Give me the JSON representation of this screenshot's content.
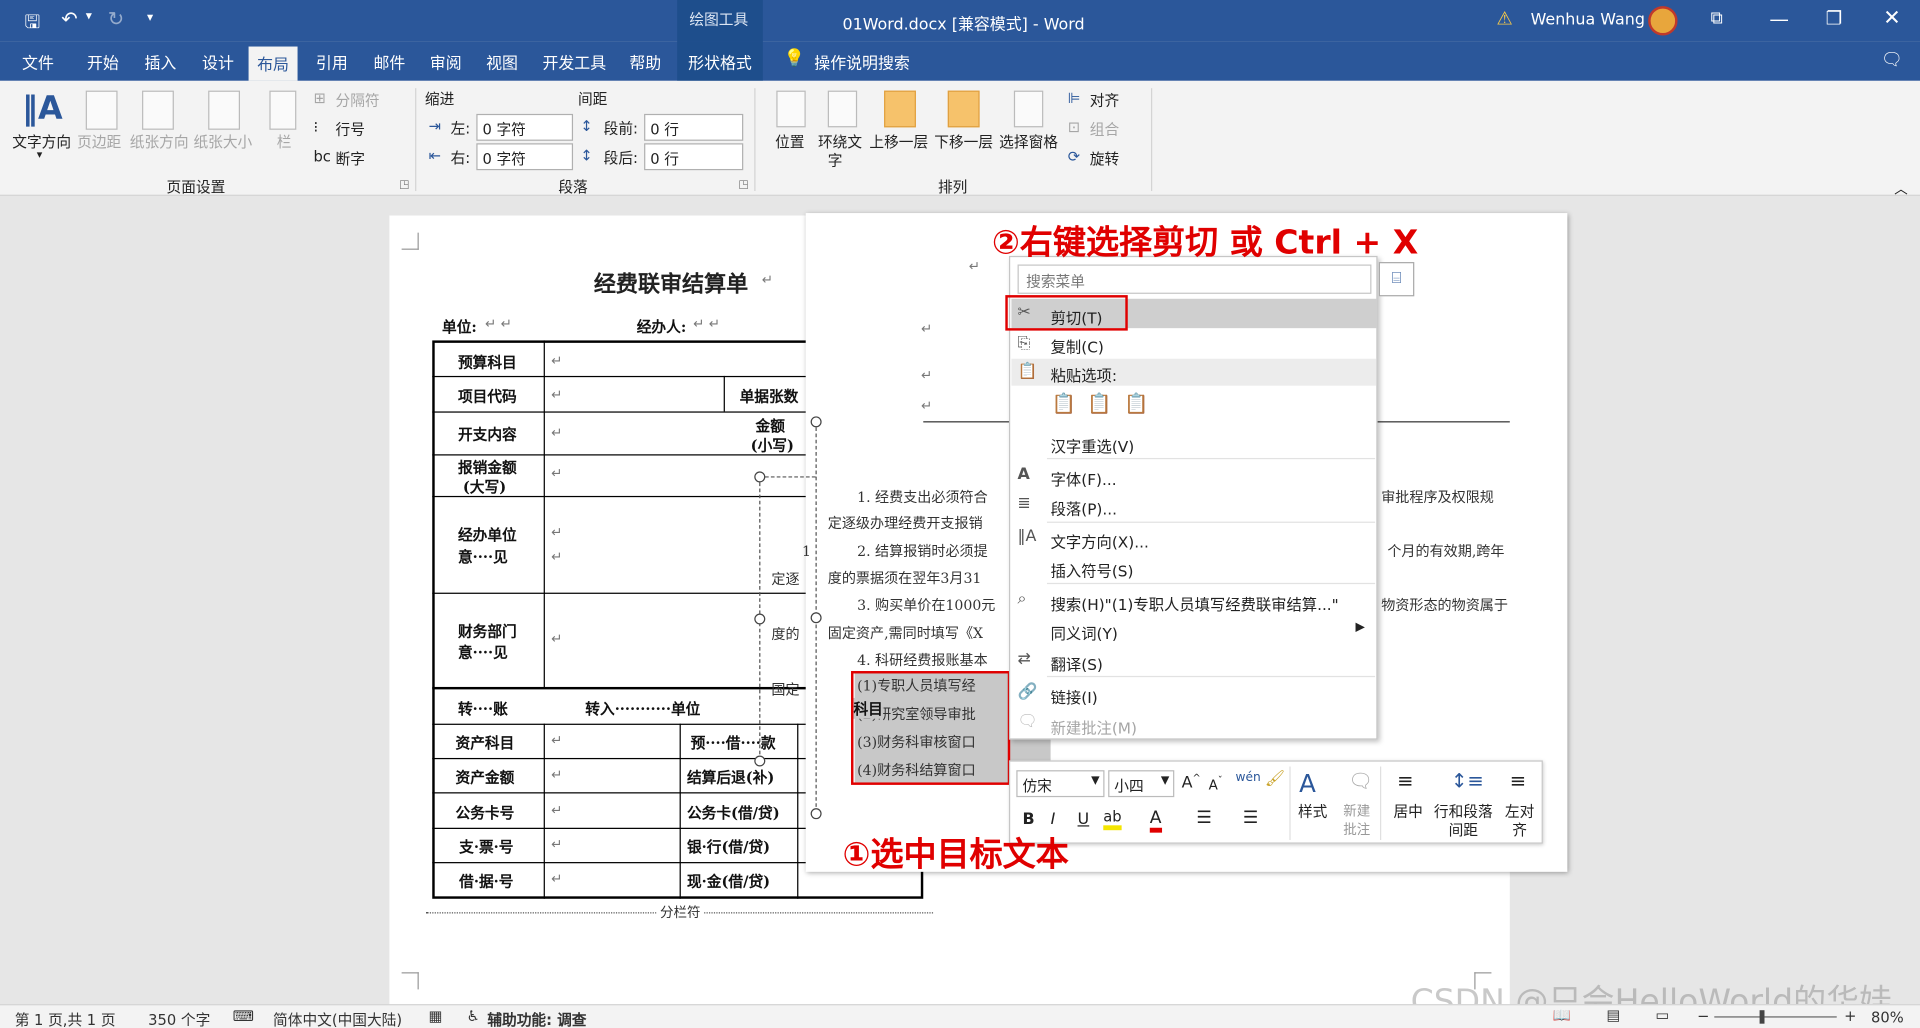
{
  "titlebar": {
    "drawing_tools": "绘图工具",
    "title": "01Word.docx [兼容模式] - Word",
    "user": "Wenhua Wang"
  },
  "tabs": [
    "文件",
    "开始",
    "插入",
    "设计",
    "布局",
    "引用",
    "邮件",
    "审阅",
    "视图",
    "开发工具",
    "帮助",
    "形状格式"
  ],
  "active_tab": "布局",
  "search_hint": "操作说明搜索",
  "ribbon": {
    "page_setup": {
      "text_dir": "文字方向",
      "margins": "页边距",
      "orientation": "纸张方向",
      "size": "纸张大小",
      "columns": "栏",
      "breaks": "分隔符",
      "line_numbers": "行号",
      "hyphenation": "断字",
      "label": "页面设置"
    },
    "paragraph": {
      "indent_label": "缩进",
      "spacing_label": "间距",
      "left": "左:",
      "right": "右:",
      "before": "段前:",
      "after": "段后:",
      "left_val": "0 字符",
      "right_val": "0 字符",
      "before_val": "0 行",
      "after_val": "0 行",
      "label": "段落"
    },
    "arrange": {
      "position": "位置",
      "wrap_line1": "环绕文",
      "wrap_line2": "字",
      "forward": "上移一层",
      "backward": "下移一层",
      "selection_pane": "选择窗格",
      "align": "对齐",
      "group": "组合",
      "rotate": "旋转",
      "label": "排列"
    }
  },
  "doc": {
    "title": "经费联审结算单",
    "unit": "单位:",
    "handler": "经办人:",
    "rows": {
      "budget": "预算科目",
      "project_code": "项目代码",
      "doc_count": "单据张数",
      "expense": "开支内容",
      "amount_small_1": "金额",
      "amount_small_2": "(小写)",
      "reimb_1": "报销金额",
      "reimb_2": "(大写)",
      "dept_1": "经办单位",
      "dept_2": "意····见",
      "fin_1": "财务部门",
      "fin_2": "意····见",
      "transfer": "转····账",
      "transfer_in": "转入···········单位",
      "subject": "科目",
      "asset_subject": "资产科目",
      "prepay": "预····借····款",
      "asset_amount": "资产金额",
      "refund": "结算后退(补)",
      "card_no": "公务卡号",
      "card": "公务卡(借/贷)",
      "cheque": "支·票·号",
      "bank": "银·行(借/贷)",
      "bill": "借·据·号",
      "cash": "现·金(借/贷)"
    },
    "column_break": "分栏符"
  },
  "pane": {
    "line1a": "1. 经费支出必须符合",
    "line1b": "审批程序及权限规",
    "line2": "定逐级办理经费开支报销",
    "line3a": "2. 结算报销时必须提",
    "line3b": "个月的有效期,跨年",
    "line4": "度的票据须在翌年3月31",
    "line5a": "3. 购买单价在1000元",
    "line5b": "物资形态的物资属于",
    "line6": "固定资产,需同时填写《X",
    "line7": "4. 科研经费报账基本",
    "sel1": "(1)专职人员填写经",
    "sel2": "(2)研究室领导审批",
    "sel3": "(3)财务科审核窗口",
    "sel4": "(4)财务科结算窗口",
    "frag1": "定逐",
    "frag2": "度的",
    "frag3": "国定",
    "frag4": "1"
  },
  "context_menu": {
    "search_placeholder": "搜索菜单",
    "cut": "剪切(T)",
    "copy": "复制(C)",
    "paste_options": "粘贴选项:",
    "reconvert": "汉字重选(V)",
    "font": "字体(F)...",
    "paragraph": "段落(P)...",
    "text_direction": "文字方向(X)...",
    "insert_symbol": "插入符号(S)",
    "search": "搜索(H)\"(1)专职人员填写经费联审结算...\"",
    "synonyms": "同义词(Y)",
    "translate": "翻译(S)",
    "link": "链接(I)",
    "new_comment": "新建批注(M)"
  },
  "mini_toolbar": {
    "font": "仿宋",
    "size": "小四",
    "styles": "样式",
    "new_comment_1": "新建",
    "new_comment_2": "批注",
    "center": "居中",
    "spacing_1": "行和段落",
    "spacing_2": "间距",
    "left_1": "左对",
    "left_2": "齐"
  },
  "annotations": {
    "step1": "①选中目标文本",
    "step2": "②右键选择剪切 或 Ctrl + X"
  },
  "status": {
    "page": "第 1 页,共 1 页",
    "words": "350 个字",
    "lang": "简体中文(中国大陆)",
    "accessibility": "辅助功能: 调查",
    "zoom": "80%"
  },
  "watermark": "CSDN @只会HelloWorld的华娃",
  "colors": {
    "accent": "#2b579a",
    "annotation": "#e00000"
  }
}
